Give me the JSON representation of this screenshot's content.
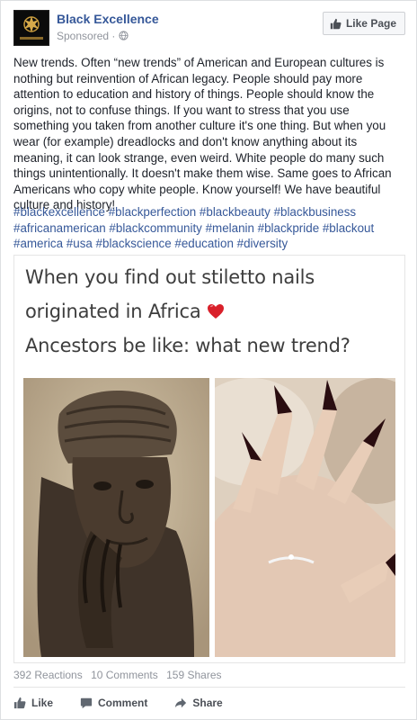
{
  "post": {
    "page_name": "Black Excellence",
    "sponsored_label": "Sponsored",
    "like_page_label": "Like Page",
    "text": "New trends. Often “new trends” of American and European cultures is nothing but reinvention of African legacy. People should pay more attention to education and history of things. People should know the origins, not to confuse things. If you want to stress that you use something you taken from another culture it's one thing. But when you wear (for example) dreadlocks and don't know anything about its meaning, it can look strange, even weird. White people do many such things unintentionally. It doesn't make them wise. Same goes to African Americans who copy white people. Know yourself! We have beautiful culture and history!",
    "hashtags": "#blackexcellence #blackperfection #blackbeauty #blackbusiness #africanamerican #blackcommunity #melanin #blackpride #blackout #america #usa #blackscience #education #diversity"
  },
  "meme": {
    "line1": "When you find out stiletto nails",
    "line2": "originated in Africa",
    "line3": "Ancestors be like: what new trend?"
  },
  "stats": {
    "reactions": "392 Reactions",
    "comments": "10 Comments",
    "shares": "159 Shares"
  },
  "actions": {
    "like": "Like",
    "comment": "Comment",
    "share": "Share"
  },
  "icons": {
    "like": "thumbs-up-icon",
    "comment": "speech-bubble-icon",
    "share": "share-arrow-icon",
    "globe": "globe-icon",
    "heart": "red-heart-icon"
  },
  "colors": {
    "link": "#365899",
    "text": "#1d2129",
    "meta": "#90949c",
    "heart": "#d9202a"
  }
}
